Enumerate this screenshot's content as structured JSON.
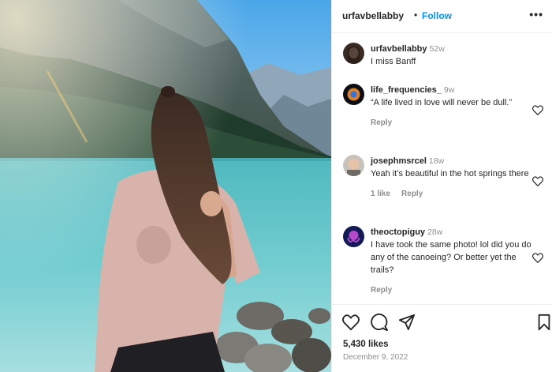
{
  "post": {
    "author": "urfavbellabby",
    "separator": "•",
    "follow_label": "Follow",
    "more_label": "•••"
  },
  "comments": [
    {
      "user": "urfavbellabby",
      "time": "52w",
      "text": "I miss Banff",
      "likes": "",
      "reply": ""
    },
    {
      "user": "life_frequencies_",
      "time": "9w",
      "text": "“A life lived in love will never be dull.”",
      "likes": "",
      "reply": "Reply"
    },
    {
      "user": "josephmsrcel",
      "time": "18w",
      "text": "Yeah it’s beautiful in the hot springs there",
      "likes": "1 like",
      "reply": "Reply"
    },
    {
      "user": "theoctopiguy",
      "time": "28w",
      "text": "I have took the same photo! lol did you do any of the canoeing? Or better yet the trails?",
      "likes": "",
      "reply": "Reply"
    }
  ],
  "footer": {
    "likes": "5,430 likes",
    "date": "December 9, 2022"
  },
  "icons": {
    "like": "heart-icon",
    "comment": "comment-icon",
    "share": "share-icon",
    "save": "bookmark-icon"
  },
  "colors": {
    "accent": "#0095f6",
    "text": "#262626",
    "muted": "#8e8e8e",
    "border": "#efefef"
  }
}
